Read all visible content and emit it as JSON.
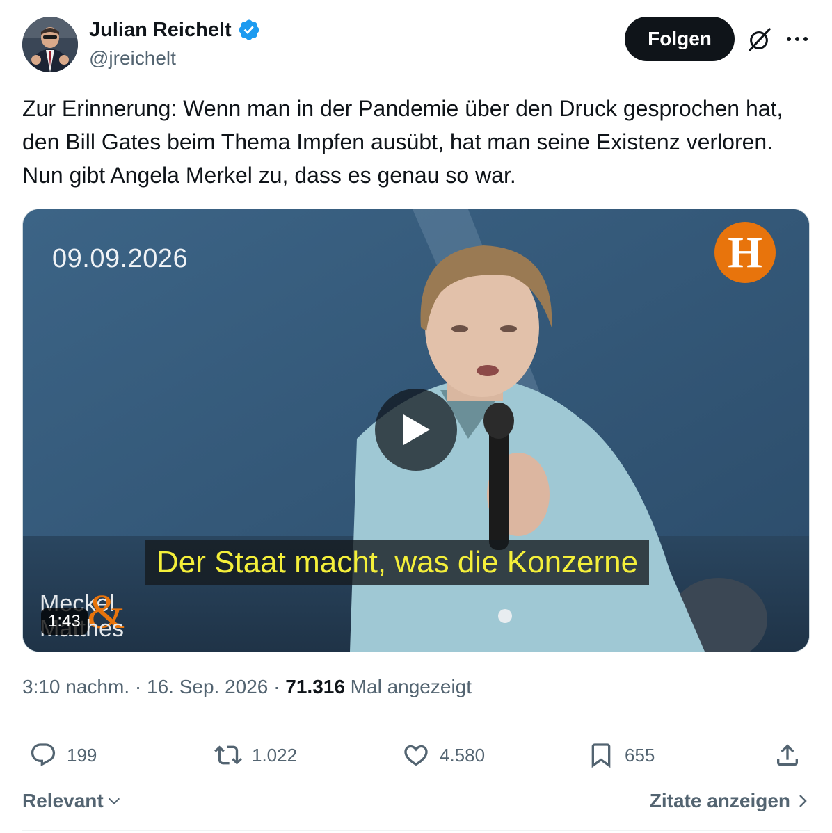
{
  "author": {
    "name": "Julian Reichelt",
    "handle": "@jreichelt",
    "avatar_icon": "avatar-photo",
    "verified_icon": "verified-badge-icon"
  },
  "header": {
    "follow_label": "Folgen",
    "grok_icon": "grok-icon",
    "more_icon": "more-icon"
  },
  "tweet": {
    "text": "Zur Erinnerung: Wenn man in der Pandemie über den Druck gesprochen hat, den Bill Gates beim Thema Impfen ausübt, hat man seine Existenz verloren. Nun gibt Angela Merkel zu, dass es genau so war."
  },
  "video": {
    "date_overlay": "09.09.2026",
    "logo_letter": "H",
    "subtitle": "Der Staat macht, was die Konzerne",
    "brand_line1": "Meckel",
    "brand_amp": "&",
    "brand_line2": "Matthes",
    "duration": "1:43",
    "play_icon": "play-icon"
  },
  "meta": {
    "time": "3:10 nachm.",
    "separator1": " · ",
    "date": "16. Sep. 2026",
    "separator2": " · ",
    "views": "71.316",
    "views_label": " Mal angezeigt"
  },
  "actions": {
    "replies": "199",
    "reposts": "1.022",
    "likes": "4.580",
    "bookmarks": "655"
  },
  "footer": {
    "sort_label": "Relevant",
    "quotes_label": "Zitate anzeigen"
  },
  "colors": {
    "accent": "#1d9bf0",
    "text": "#0f1419",
    "secondary": "#536471",
    "subtitle_yellow": "#f4ef3a",
    "logo_orange": "#e8740c"
  }
}
